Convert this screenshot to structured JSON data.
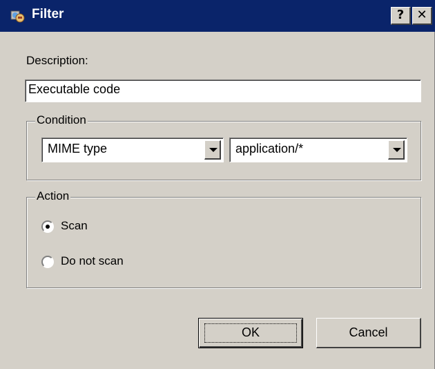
{
  "window": {
    "title": "Filter",
    "help_glyph": "?",
    "close_glyph": "✕",
    "icon": "filter-app-icon"
  },
  "description": {
    "label": "Description:",
    "value": "Executable code"
  },
  "condition": {
    "legend": "Condition",
    "field": {
      "selected": "MIME type"
    },
    "value": {
      "selected": "application/*"
    }
  },
  "action": {
    "legend": "Action",
    "options": [
      {
        "label": "Scan",
        "checked": true
      },
      {
        "label": "Do not scan",
        "checked": false
      }
    ]
  },
  "buttons": {
    "ok": "OK",
    "cancel": "Cancel"
  },
  "colors": {
    "titlebar": "#0a246a",
    "face": "#d4d0c8"
  }
}
